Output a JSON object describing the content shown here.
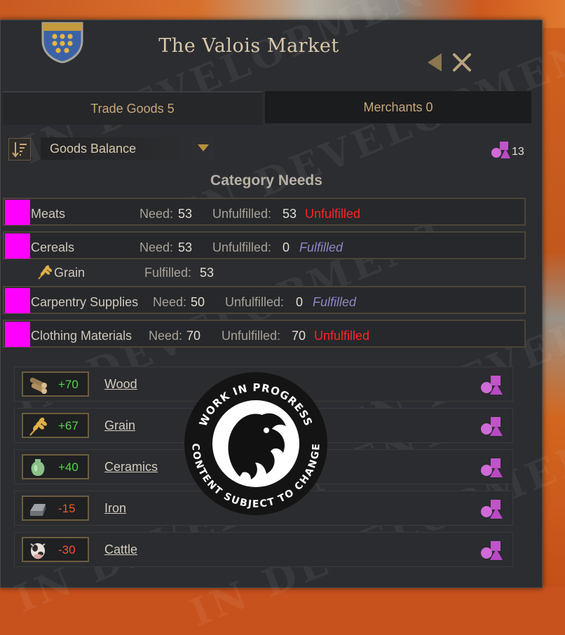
{
  "window": {
    "title": "The Valois Market",
    "accent_color": "#d8c8a8"
  },
  "tabs": [
    {
      "label": "Trade Goods 5",
      "active": true
    },
    {
      "label": "Merchants 0",
      "active": false
    }
  ],
  "sort": {
    "icon": "sort-icon",
    "dropdown_value": "Goods Balance"
  },
  "merchants_available": {
    "icon": "merchant-shapes-icon",
    "count": "13"
  },
  "category_needs": {
    "title": "Category Needs",
    "need_label": "Need:",
    "unfulfilled_label": "Unfulfilled:",
    "fulfilled_label": "Fulfilled:",
    "placeholder_color": "#ff00ff",
    "rows": [
      {
        "name": "Meats",
        "need": "53",
        "unfulfilled": "53",
        "status": "Unfulfilled"
      },
      {
        "name": "Cereals",
        "need": "53",
        "unfulfilled": "0",
        "status": "Fulfilled",
        "sub": {
          "name": "Grain",
          "icon": "wheat-icon",
          "fulfilled": "53"
        }
      },
      {
        "name": "Carpentry Supplies",
        "need": "50",
        "unfulfilled": "0",
        "status": "Fulfilled"
      },
      {
        "name": "Clothing Materials",
        "need": "70",
        "unfulfilled": "70",
        "status": "Unfulfilled"
      }
    ]
  },
  "goods": [
    {
      "name": "Wood",
      "delta": "+70",
      "icon": "wood-logs-icon",
      "trade_icon": "trade-shapes-icon"
    },
    {
      "name": "Grain",
      "delta": "+67",
      "icon": "wheat-icon",
      "trade_icon": "trade-shapes-icon"
    },
    {
      "name": "Ceramics",
      "delta": "+40",
      "icon": "vase-icon",
      "trade_icon": "trade-shapes-icon"
    },
    {
      "name": "Iron",
      "delta": "-15",
      "icon": "iron-ingot-icon",
      "trade_icon": "trade-shapes-icon"
    },
    {
      "name": "Cattle",
      "delta": "-30",
      "icon": "cow-icon",
      "trade_icon": "trade-shapes-icon"
    }
  ],
  "watermark": {
    "text": "IN DEVELOPMENT",
    "badge_top": "WORK IN PROGRESS",
    "badge_bottom": "CONTENT SUBJECT TO CHANGE"
  },
  "colors": {
    "positive": "#55d34a",
    "negative": "#f0562e",
    "unfulfilled": "#ff2323",
    "fulfilled": "#8e86c4"
  }
}
